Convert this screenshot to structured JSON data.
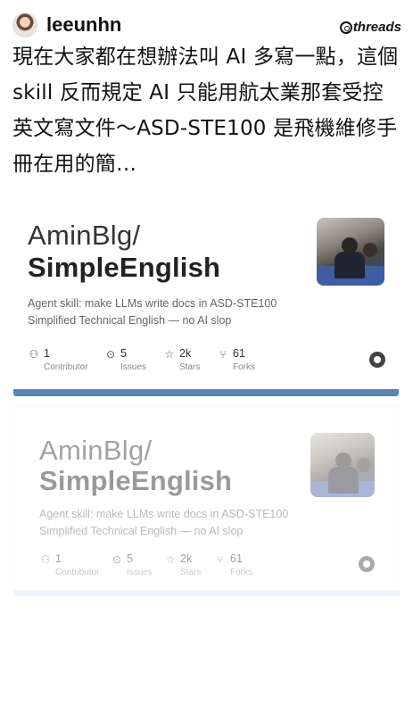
{
  "header": {
    "username": "leeunhn",
    "brand": "threads",
    "icons": {
      "avatar": "profile-photo",
      "brand": "threads-logo-icon"
    }
  },
  "post": {
    "text": "現在大家都在想辦法叫 AI 多寫一點，這個 skill 反而規定 AI 只能用航太業那套受控英文寫文件～ASD-STE100 是飛機維修手冊在用的簡…"
  },
  "cards": [
    {
      "owner": "AminBlg/",
      "repo": "SimpleEnglish",
      "description": "Agent skill: make LLMs write docs in ASD-STE100 Simplified Technical English — no AI slop",
      "stats": [
        {
          "icon": "contributors-icon",
          "value": "1",
          "label": "Contributor"
        },
        {
          "icon": "issues-icon",
          "value": "5",
          "label": "Issues"
        },
        {
          "icon": "star-icon",
          "value": "2k",
          "label": "Stars"
        },
        {
          "icon": "fork-icon",
          "value": "61",
          "label": "Forks"
        }
      ],
      "accent": "#5b84b4"
    },
    {
      "owner": "AminBlg/",
      "repo": "SimpleEnglish",
      "description": "Agent skill: make LLMs write docs in ASD-STE100 Simplified Technical English — no AI slop",
      "stats": [
        {
          "icon": "contributors-icon",
          "value": "1",
          "label": "Contributor"
        },
        {
          "icon": "issues-icon",
          "value": "5",
          "label": "Issues"
        },
        {
          "icon": "star-icon",
          "value": "2k",
          "label": "Stars"
        },
        {
          "icon": "fork-icon",
          "value": "61",
          "label": "Forks"
        }
      ],
      "accent": "#dbe5f0"
    }
  ]
}
